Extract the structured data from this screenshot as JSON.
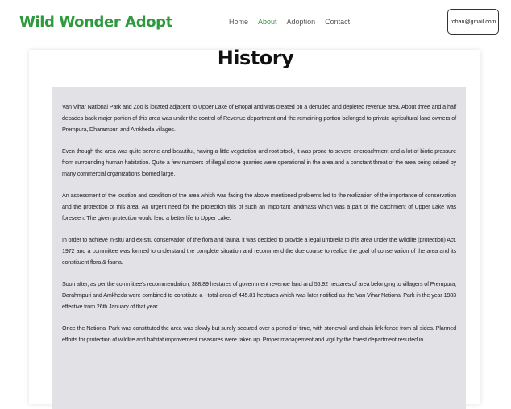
{
  "brand": "Wild Wonder Adopt",
  "nav": {
    "home": "Home",
    "about": "About",
    "adoption": "Adoption",
    "contact": "Contact"
  },
  "user_email": "rohan@gmail.com",
  "page_title": "History",
  "paragraphs": [
    "Van Vihar National Park and Zoo is located adjacent to Upper Lake of Bhopal and was created on a denuded and depleted revenue area. About three and a half decades back major portion of this area was under the control of Revenue department and the remaining portion belonged to private agricultural land owners of Prempura, Dharampuri and Amkheda villages.",
    "Even though the area was quite serene and beautiful, having a little vegetation and root stock, it was prone to severe encroachment and a lot of biotic pressure from surrounding human habitation. Quite a few numbers of illegal stone quarries were operational in the area and a constant threat of the area being seized by many commercial organizations loomed large.",
    "An assessment of the location and condition of the area which was facing the above mentioned problems led to the realization of the importance of conservation and the protection of this area. An urgent need for the protection this of such an important landmass which was a part of the catchment of Upper Lake was foreseen. The given protection would lend a better life to Upper Lake.",
    "In order to achieve in-situ and ex-situ conservation of the flora and fauna, it was decided to provide a legal umbrella to this area under the Wildlife (protection) Act, 1972 and a committee was formed to understand the complete situation and recommend the due course to realize the goal of conservation of the area and its constituent flora & fauna.",
    "Soon after, as per the committee's recommendation, 388.89 hectares of government revenue land and 56.92 hectares of area belonging to villagers of Prempura, Darahmpuri and Amkheda were combined to constitute a - total area of 445.81 hectares which was later notified as the Van Vihar National Park in the year 1983 effective from 26th January of that year.",
    "Once the National Park was constituted the area was slowly but surely secured over a period of time, with stonewall and chain link fence from all sides. Planned efforts for protection of wildlife and habitat improvement measures were taken up. Proper management and vigil by the forest department resulted in"
  ],
  "colors": {
    "brand_green": "#2e9a3e",
    "content_bg": "#e1e1e6"
  }
}
